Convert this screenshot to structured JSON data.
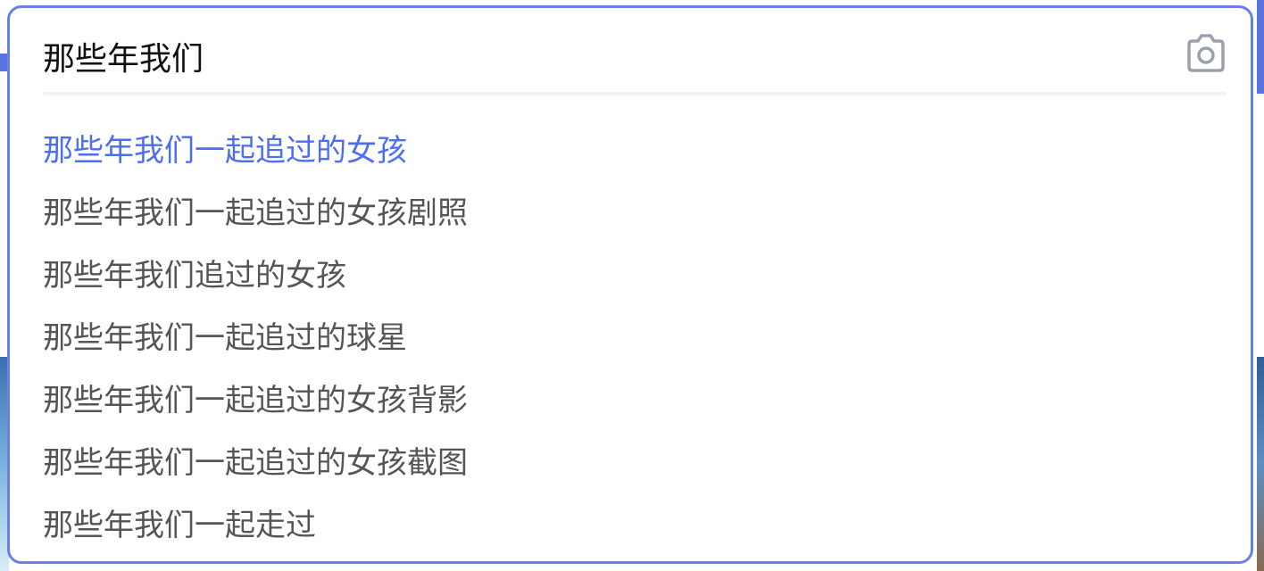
{
  "search": {
    "query": "那些年我们",
    "camera_icon": "camera-icon"
  },
  "suggestions": [
    {
      "text": "那些年我们一起追过的女孩",
      "highlighted": true
    },
    {
      "text": "那些年我们一起追过的女孩剧照",
      "highlighted": false
    },
    {
      "text": "那些年我们追过的女孩",
      "highlighted": false
    },
    {
      "text": "那些年我们一起追过的球星",
      "highlighted": false
    },
    {
      "text": "那些年我们一起追过的女孩背影",
      "highlighted": false
    },
    {
      "text": "那些年我们一起追过的女孩截图",
      "highlighted": false
    },
    {
      "text": "那些年我们一起走过",
      "highlighted": false
    }
  ],
  "colors": {
    "border": "#6a80e6",
    "highlight": "#4e6ef2",
    "suggestion_text": "#555555",
    "query_text": "#111111",
    "icon": "#9aa0ad"
  }
}
